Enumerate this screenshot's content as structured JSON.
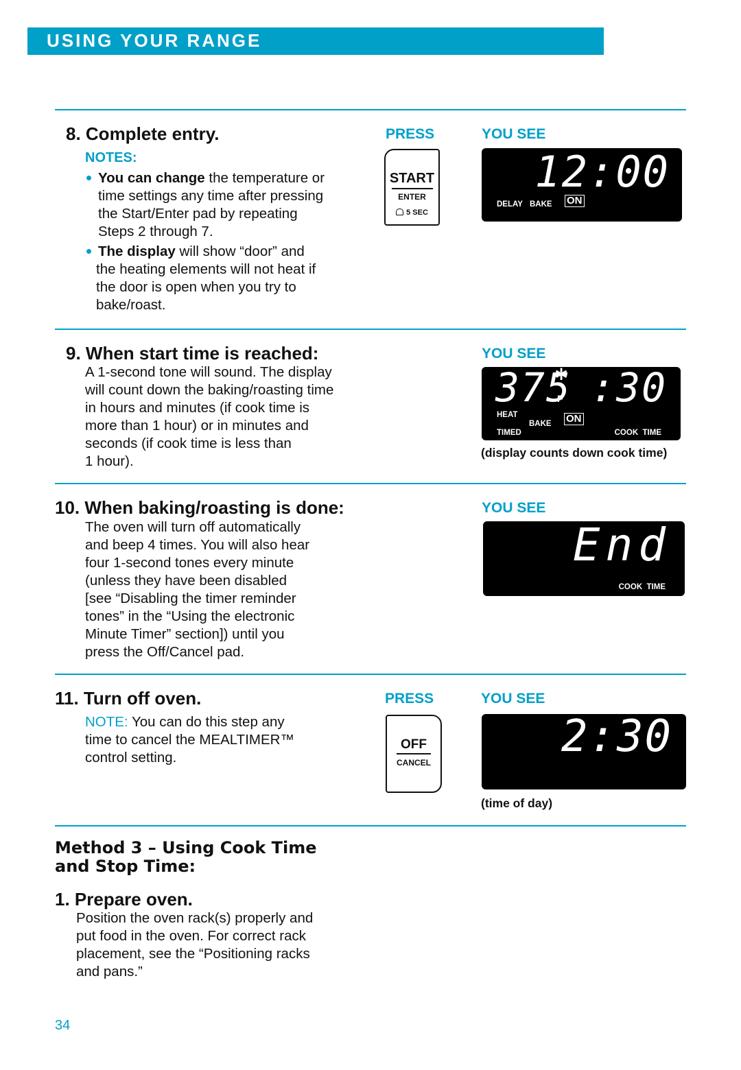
{
  "header": {
    "title": "USING YOUR RANGE"
  },
  "labels": {
    "press": "PRESS",
    "you_see": "YOU SEE",
    "notes": "NOTES:",
    "note": "NOTE:"
  },
  "steps": [
    {
      "heading": "8. Complete entry.",
      "notes": [
        {
          "bold": "You can change",
          "text": " the temperature or",
          "lines": [
            "time settings any time after pressing",
            "the Start/Enter pad by repeating",
            "Steps 2 through 7."
          ]
        },
        {
          "bold": "The display",
          "text": " will show “door” and",
          "lines": [
            "the heating elements will not heat if",
            "the door is open when you try to",
            "bake/roast."
          ]
        }
      ],
      "pad": {
        "top": "START",
        "bottom": "ENTER",
        "lock": "5 SEC"
      },
      "display": {
        "digits": "12:00",
        "labels": [
          "DELAY",
          "BAKE"
        ],
        "on": "ON"
      }
    },
    {
      "heading": "9. When start time is reached:",
      "body": [
        "A 1-second tone will sound. The display",
        "will count down the baking/roasting time",
        "in hours and minutes (if cook time is",
        "more than 1 hour) or in minutes and",
        "seconds (if cook time is less than",
        "1 hour)."
      ],
      "display": {
        "temp": "375",
        "unit": "F",
        "time": ":30",
        "labels": [
          "HEAT",
          "TIMED",
          "BAKE",
          "COOK  TIME"
        ],
        "on": "ON"
      },
      "caption": "(display counts down cook time)"
    },
    {
      "heading": "10. When baking/roasting is done:",
      "body": [
        "The oven will turn off automatically",
        "and beep 4 times. You will also hear",
        "four 1-second tones every minute",
        "(unless they have been disabled",
        "[see “Disabling the timer reminder",
        "tones” in the “Using the electronic",
        "Minute Timer” section]) until you",
        "press the Off/Cancel pad."
      ],
      "display": {
        "digits": "End",
        "labels": [
          "COOK  TIME"
        ]
      }
    },
    {
      "heading": "11. Turn off oven.",
      "note_lines": [
        " You can do this step any",
        "time to cancel the MEALTIMER™",
        "control setting."
      ],
      "pad": {
        "top": "OFF",
        "bottom": "CANCEL"
      },
      "display": {
        "digits": "2:30"
      },
      "caption": "(time of day)"
    }
  ],
  "method": {
    "title_lines": [
      "Method 3 – Using Cook Time",
      "and Stop Time:"
    ],
    "step": {
      "heading": "1. Prepare oven.",
      "body": [
        "Position the oven rack(s) properly and",
        "put food in the oven. For correct rack",
        "placement, see the “Positioning racks",
        "and pans.”"
      ]
    }
  },
  "page_number": "34"
}
